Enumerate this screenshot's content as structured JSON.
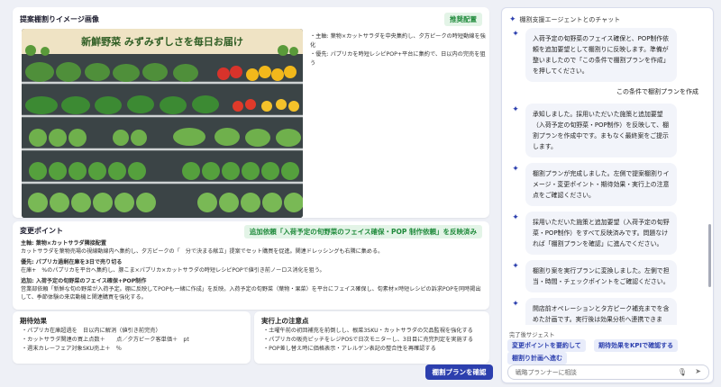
{
  "image_panel": {
    "title": "提案棚割りイメージ画像",
    "badge": "推奨配置",
    "poster_text": "新鮮野菜 みずみずしさを毎日お届け",
    "notes": [
      "・主軸: 葉物×カットサラダを中央集約し、夕方ピークの時短動線を強化",
      "・優先: パプリカを時短レシピPOP+平台に集約で、日以内の完売を狙う"
    ]
  },
  "change_points": {
    "title": "変更ポイント",
    "badge": "追加依頼「入荷予定の旬野菜のフェイス確保・POP 制作依頼」を反映済み",
    "lines": [
      "主軸: 葉物×カットサラダ隣接配置",
      "カットサラダを葉物売場の視線動線内へ集約し、夕方ピークの「　分で決まる献立」提案でセット購買を促進。関連ドレッシングも右隣に集める。",
      "",
      "優先: パプリカ過剰在庫を3日で売り切る",
      "在庫+　%のパプリカを平台へ集約し、豚こま×パプリカ×カットサラダの時短レシピPOPで値引き前ノーロス消化を狙う。",
      "",
      "追加: 入荷予定の旬野菜のフェイス確保+POP制作",
      "営業部依頼「新鮮な旬の野菜が入荷予定。棚に反映してPOPも一緒に作成」を反映。入荷予定の旬野菜（葉物・果菜）を平台にフェイス確保し、旬素材×時短レシピの訴求POPを同時掲出して、季節体験の来店動機と関連購買を強化する。"
    ]
  },
  "effects": {
    "title": "期待効果",
    "items": [
      "・パプリカ在庫超過を　日以内に解消（値引き前完売）",
      "・カットサラダ関連の買上点数＋　　点／夕方ピーク客単価＋　pt",
      "・週末カレーフェア対象SKU売上＋　％"
    ]
  },
  "execution": {
    "title": "実行上の注意点",
    "items": [
      "・土曜午前の初回補充を前倒しし、根菜3SKU・カットサラダの欠品監視を強化する",
      "・パプリカの販売ピッチをレジPOSで日次モニターし、3日目に売完判定を実施する",
      "・POP差し替え時に価格表示・アレルゲン表記の整合性を再確認する"
    ]
  },
  "confirm_button": "棚割プランを確認",
  "chat": {
    "header": "棚割支援エージェントとのチャット",
    "messages": [
      {
        "role": "agent",
        "text": "入荷予定の旬野菜のフェイス確保と、POP制作依頼を追加要望として棚割りに反映します。準備が整いましたので「この条件で棚割プランを作成」を押してください。"
      },
      {
        "role": "user",
        "text": "この条件で棚割プランを作成"
      },
      {
        "role": "agent",
        "text": "承知しました。採用いただいた施策と追加要望（入荷予定の旬野菜・POP制作）を反映して、棚割プランを作成中です。まもなく最終案をご提示します。"
      },
      {
        "role": "agent",
        "text": "棚割プランが完成しました。左側で提案棚割りイメージ・変更ポイント・期待効果・実行上の注意点をご確認ください。"
      },
      {
        "role": "agent",
        "text": "採用いただいた施策と追加要望（入荷予定の旬野菜・POP制作）をすべて反映済みです。問題なければ「棚割プランを確認」に進んでください。"
      },
      {
        "role": "agent",
        "text": "棚割り案を実行プランに変換しました。左側で担当・時間・チェックポイントをご確認ください。"
      },
      {
        "role": "agent",
        "text": "開店前オペレーションとタ方ピーク補充までを含めた計画です。実行後は効果分析へ連携できます。"
      }
    ],
    "suggestions_label": "完了後サジェスト",
    "suggestions": [
      "変更ポイントを要約して",
      "期待効果をKPIで確認する",
      "棚割り計画へ進む"
    ],
    "input_placeholder": "戦略プランナーに相談"
  },
  "colors": {
    "accent": "#2c3fae",
    "badge_green": "#1f8a3b",
    "badge_bg": "#e3f4e7"
  }
}
